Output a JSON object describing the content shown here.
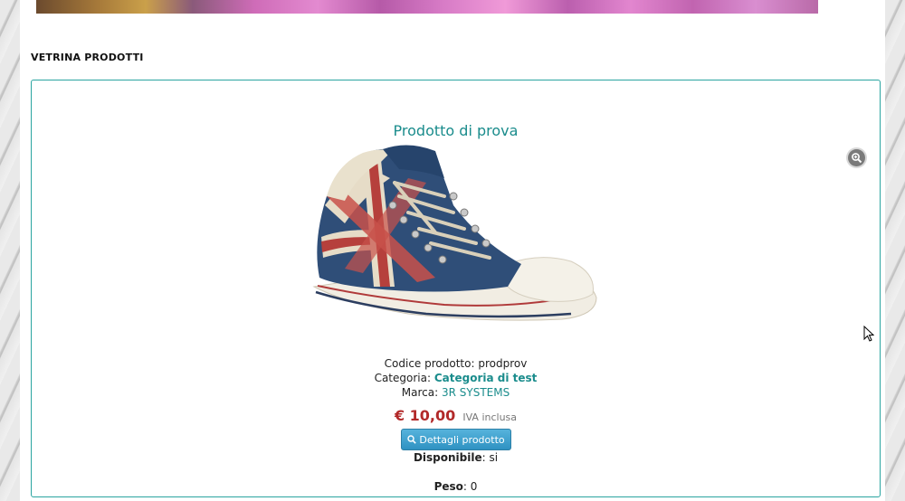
{
  "section": {
    "title": "VETRINA PRODOTTI"
  },
  "product": {
    "name": "Prodotto di prova",
    "code_label": "Codice prodotto:",
    "code_value": "prodprov",
    "category_label": "Categoria:",
    "category_value": "Categoria di test",
    "brand_label": "Marca:",
    "brand_value": "3R SYSTEMS",
    "price": "€ 10,00",
    "vat_note": "IVA inclusa",
    "details_button": "Dettagli prodotto",
    "availability_label": "Disponibile",
    "availability_value": "si",
    "weight_label": "Peso",
    "weight_value": "0"
  },
  "icons": {
    "zoom": "zoom-icon",
    "details": "magnifier-icon"
  },
  "colors": {
    "accent": "#1a8c8c",
    "panel_border": "#2aa4a0",
    "price": "#b22a2a",
    "button": "#3a9fd0"
  }
}
